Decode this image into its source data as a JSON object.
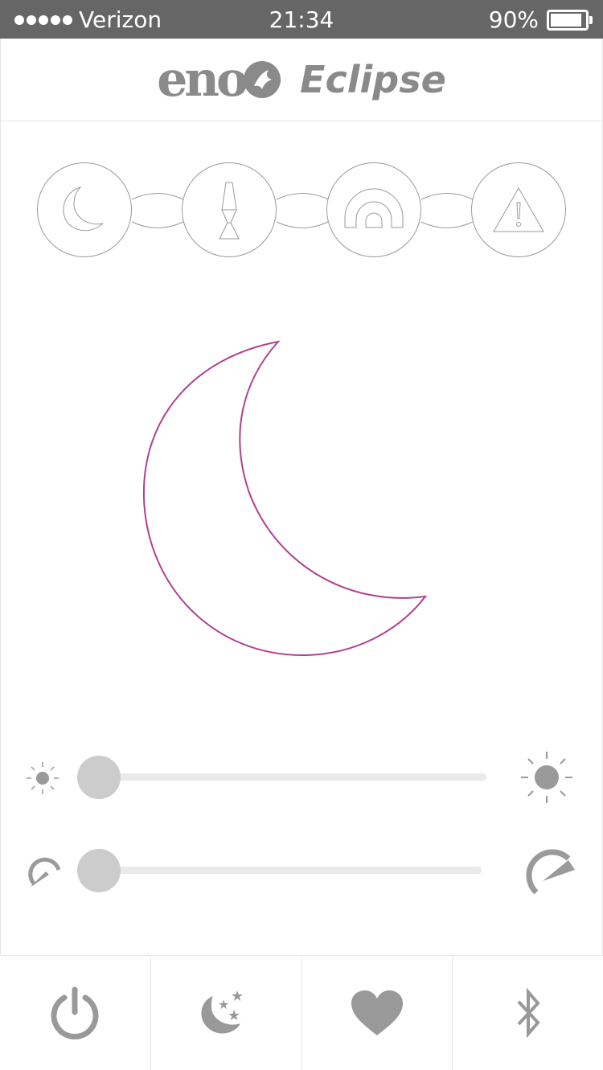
{
  "status_bar": {
    "carrier": "Verizon",
    "time": "21:34",
    "battery_percent": "90%",
    "battery_level": 0.9
  },
  "header": {
    "brand": "eno",
    "product": "Eclipse"
  },
  "modes": [
    {
      "icon": "moon-icon",
      "selected": true
    },
    {
      "icon": "lava-lamp-icon",
      "selected": false
    },
    {
      "icon": "rainbow-icon",
      "selected": false
    },
    {
      "icon": "warning-icon",
      "selected": false
    }
  ],
  "current_mode_icon": "moon-icon",
  "accent_color": "#b04090",
  "brightness": {
    "min_icon": "sun-small-icon",
    "max_icon": "sun-large-icon",
    "value": 0.0
  },
  "speed": {
    "min_icon": "speedometer-slow-icon",
    "max_icon": "speedometer-fast-icon",
    "value": 0.0
  },
  "bottom_bar": [
    {
      "icon": "power-icon"
    },
    {
      "icon": "moon-stars-icon"
    },
    {
      "icon": "heart-icon"
    },
    {
      "icon": "bluetooth-icon"
    }
  ]
}
